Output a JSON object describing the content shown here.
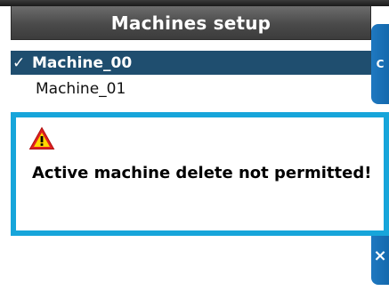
{
  "window": {
    "title": "Machines setup"
  },
  "machines": {
    "items": [
      {
        "check": "✓",
        "label": "Machine_00",
        "selected": true
      },
      {
        "check": "",
        "label": "Machine_01",
        "selected": false
      }
    ]
  },
  "side_buttons": {
    "top_label": "C",
    "bottom_label": "×"
  },
  "dialog": {
    "icon": "warning-icon",
    "message": "Active machine delete not permitted!"
  },
  "colors": {
    "accent": "#17a5da",
    "selection": "#1f4e6f",
    "side_button": "#1f78c0",
    "warning": "#e02020"
  }
}
